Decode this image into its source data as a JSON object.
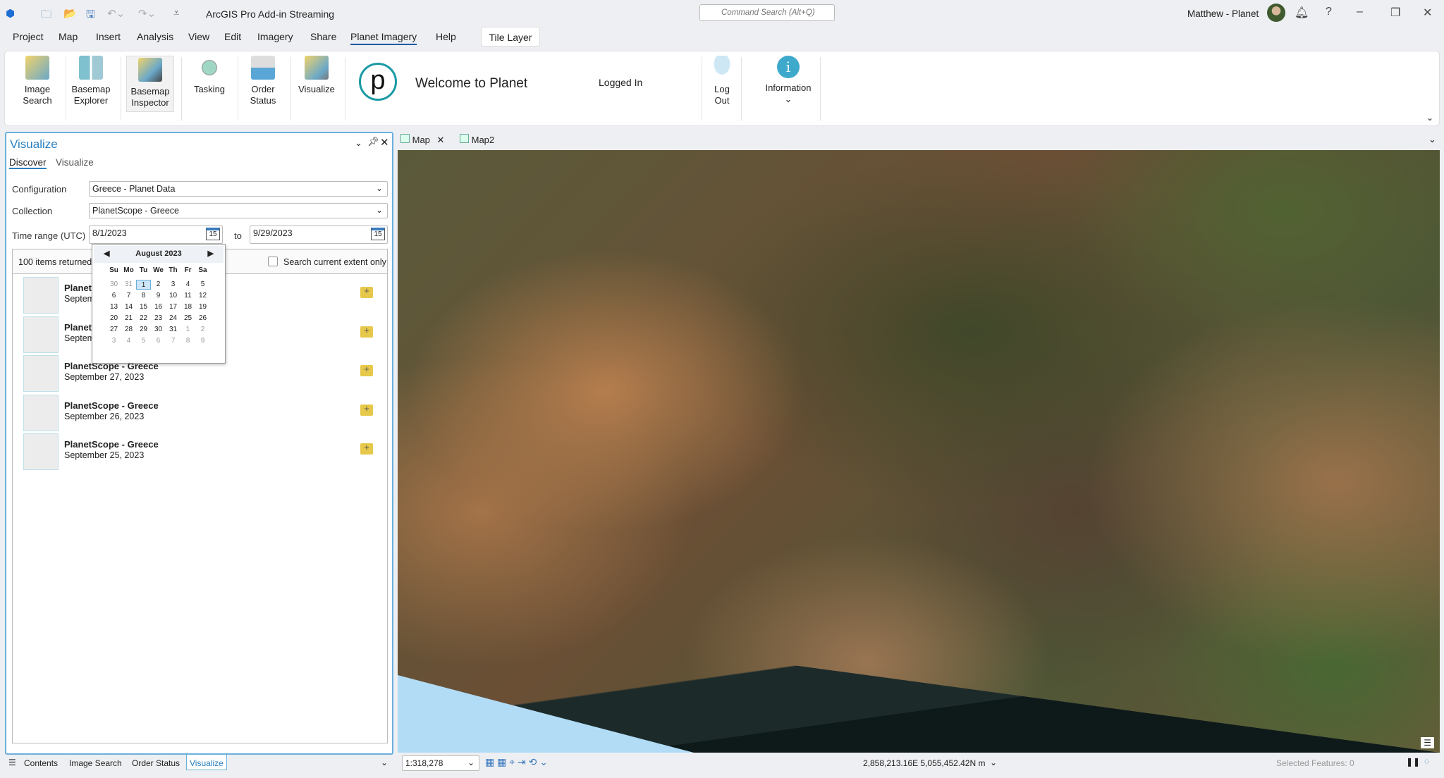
{
  "titlebar": {
    "app_title": "ArcGIS Pro Add-in Streaming",
    "search_placeholder": "Command Search (Alt+Q)",
    "user": "Matthew - Planet",
    "help": "?",
    "minimize": "–",
    "restore": "❐",
    "close": "✕"
  },
  "menu": [
    "Project",
    "Map",
    "Insert",
    "Analysis",
    "View",
    "Edit",
    "Imagery",
    "Share",
    "Planet Imagery",
    "Help"
  ],
  "contextual_tab": "Tile Layer",
  "ribbon": {
    "buttons": [
      {
        "line1": "Image",
        "line2": "Search"
      },
      {
        "line1": "Basemap",
        "line2": "Explorer"
      },
      {
        "line1": "Basemap",
        "line2": "Inspector"
      },
      {
        "line1": "Tasking",
        "line2": ""
      },
      {
        "line1": "Order",
        "line2": "Status"
      },
      {
        "line1": "Visualize",
        "line2": ""
      },
      {
        "line1": "Log",
        "line2": "Out"
      },
      {
        "line1": "Information",
        "line2": "⌄"
      }
    ],
    "logo_letter": "p",
    "welcome": "Welcome to Planet",
    "status": "Logged In"
  },
  "pane": {
    "title": "Visualize",
    "tabs": [
      "Discover",
      "Visualize"
    ],
    "config_label": "Configuration",
    "config_value": "Greece - Planet Data",
    "collection_label": "Collection",
    "collection_value": "PlanetScope - Greece",
    "time_label": "Time range (UTC)",
    "start": "8/1/2023",
    "to": "to",
    "end": "9/29/2023",
    "cal_icon_text": "15",
    "count": "100 items returned",
    "extent_label": "Search current extent only",
    "items": [
      {
        "title": "PlanetScope - Greece",
        "date": "September 29, 2023"
      },
      {
        "title": "PlanetScope - Greece",
        "date": "September 28, 2023"
      },
      {
        "title": "PlanetScope - Greece",
        "date": "September 27, 2023"
      },
      {
        "title": "PlanetScope - Greece",
        "date": "September 26, 2023"
      },
      {
        "title": "PlanetScope - Greece",
        "date": "September 25, 2023"
      }
    ]
  },
  "calendar": {
    "month": "August 2023",
    "weekdays": [
      "Su",
      "Mo",
      "Tu",
      "We",
      "Th",
      "Fr",
      "Sa"
    ],
    "days": [
      "30",
      "31",
      "1",
      "2",
      "3",
      "4",
      "5",
      "6",
      "7",
      "8",
      "9",
      "10",
      "11",
      "12",
      "13",
      "14",
      "15",
      "16",
      "17",
      "18",
      "19",
      "20",
      "21",
      "22",
      "23",
      "24",
      "25",
      "26",
      "27",
      "28",
      "29",
      "30",
      "31",
      "1",
      "2",
      "3",
      "4",
      "5",
      "6",
      "7",
      "8",
      "9"
    ]
  },
  "bottom_tabs": [
    "Contents",
    "Image Search",
    "Order Status",
    "Visualize"
  ],
  "map_tabs": [
    "Map",
    "Map2"
  ],
  "statusbar": {
    "scale": "1:318,278",
    "coords": "2,858,213.16E 5,055,452.42N m",
    "selected": "Selected Features: 0"
  }
}
